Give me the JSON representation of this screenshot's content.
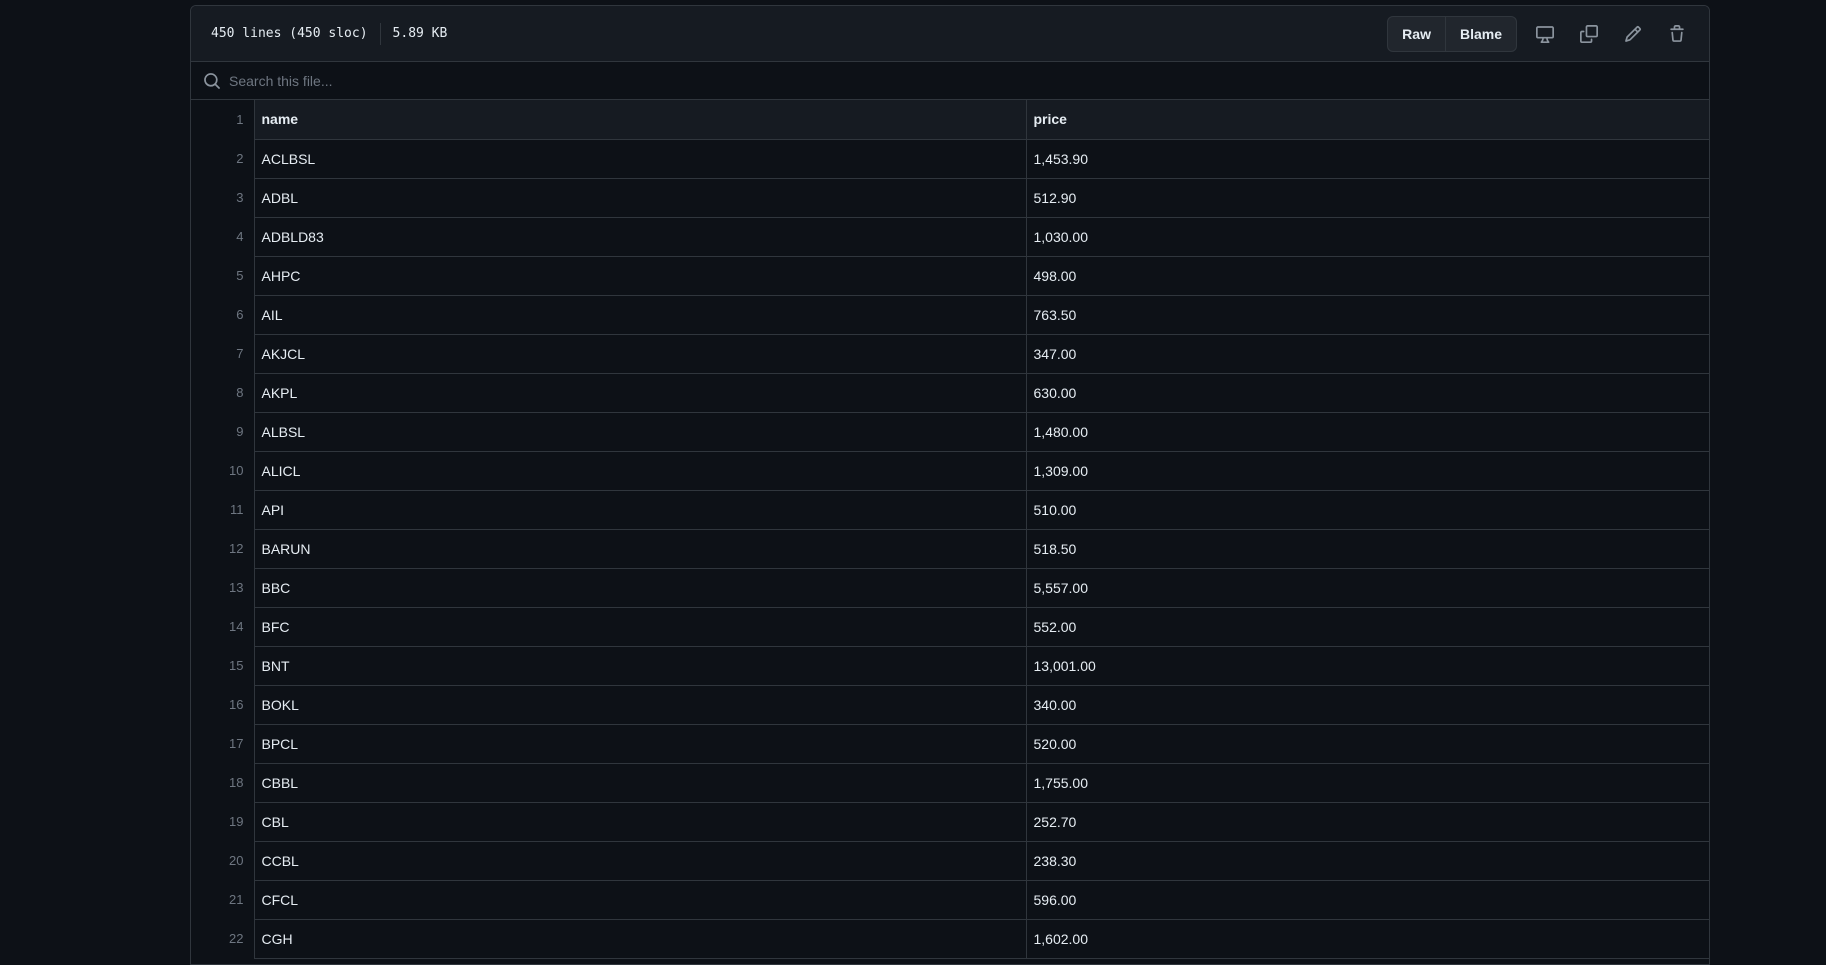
{
  "file": {
    "lines": "450 lines (450 sloc)",
    "size": "5.89 KB"
  },
  "toolbar": {
    "raw_label": "Raw",
    "blame_label": "Blame",
    "icons": [
      "desktop-icon",
      "copy-icon",
      "pencil-icon",
      "trash-icon"
    ]
  },
  "search": {
    "placeholder": "Search this file..."
  },
  "table": {
    "headers": [
      "name",
      "price"
    ],
    "rows": [
      [
        "ACLBSL",
        "1,453.90"
      ],
      [
        "ADBL",
        "512.90"
      ],
      [
        "ADBLD83",
        "1,030.00"
      ],
      [
        "AHPC",
        "498.00"
      ],
      [
        "AIL",
        "763.50"
      ],
      [
        "AKJCL",
        "347.00"
      ],
      [
        "AKPL",
        "630.00"
      ],
      [
        "ALBSL",
        "1,480.00"
      ],
      [
        "ALICL",
        "1,309.00"
      ],
      [
        "API",
        "510.00"
      ],
      [
        "BARUN",
        "518.50"
      ],
      [
        "BBC",
        "5,557.00"
      ],
      [
        "BFC",
        "552.00"
      ],
      [
        "BNT",
        "13,001.00"
      ],
      [
        "BOKL",
        "340.00"
      ],
      [
        "BPCL",
        "520.00"
      ],
      [
        "CBBL",
        "1,755.00"
      ],
      [
        "CBL",
        "252.70"
      ],
      [
        "CCBL",
        "238.30"
      ],
      [
        "CFCL",
        "596.00"
      ],
      [
        "CGH",
        "1,602.00"
      ]
    ]
  },
  "colors": {
    "background": "#0d1117",
    "header_bg": "#161b22",
    "border": "#30363d",
    "text": "#e6edf3",
    "muted": "#6e7681"
  }
}
